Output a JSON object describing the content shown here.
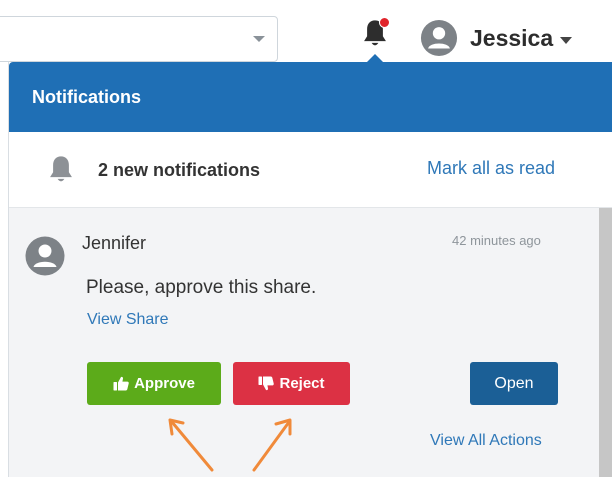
{
  "header": {
    "user_name": "Jessica",
    "avatar_icon": "user-avatar-icon",
    "bell_icon": "bell-icon",
    "has_unread_dot": true,
    "unread_dot_color": "#e0242b"
  },
  "notifications": {
    "title": "Notifications",
    "header_color": "#1f6fb5",
    "summary_text": "2 new notifications",
    "mark_all_label": "Mark all as read",
    "items": [
      {
        "sender": "Jennifer",
        "time": "42 minutes ago",
        "message": "Please, approve this share.",
        "link_label": "View Share",
        "approve_label": "Approve",
        "reject_label": "Reject",
        "open_label": "Open",
        "view_all_label": "View All Actions"
      }
    ]
  },
  "colors": {
    "approve": "#5cab1a",
    "reject": "#dc3144",
    "open": "#1b5f96",
    "link": "#2f78b8",
    "annotation_arrow": "#f08a3a"
  }
}
